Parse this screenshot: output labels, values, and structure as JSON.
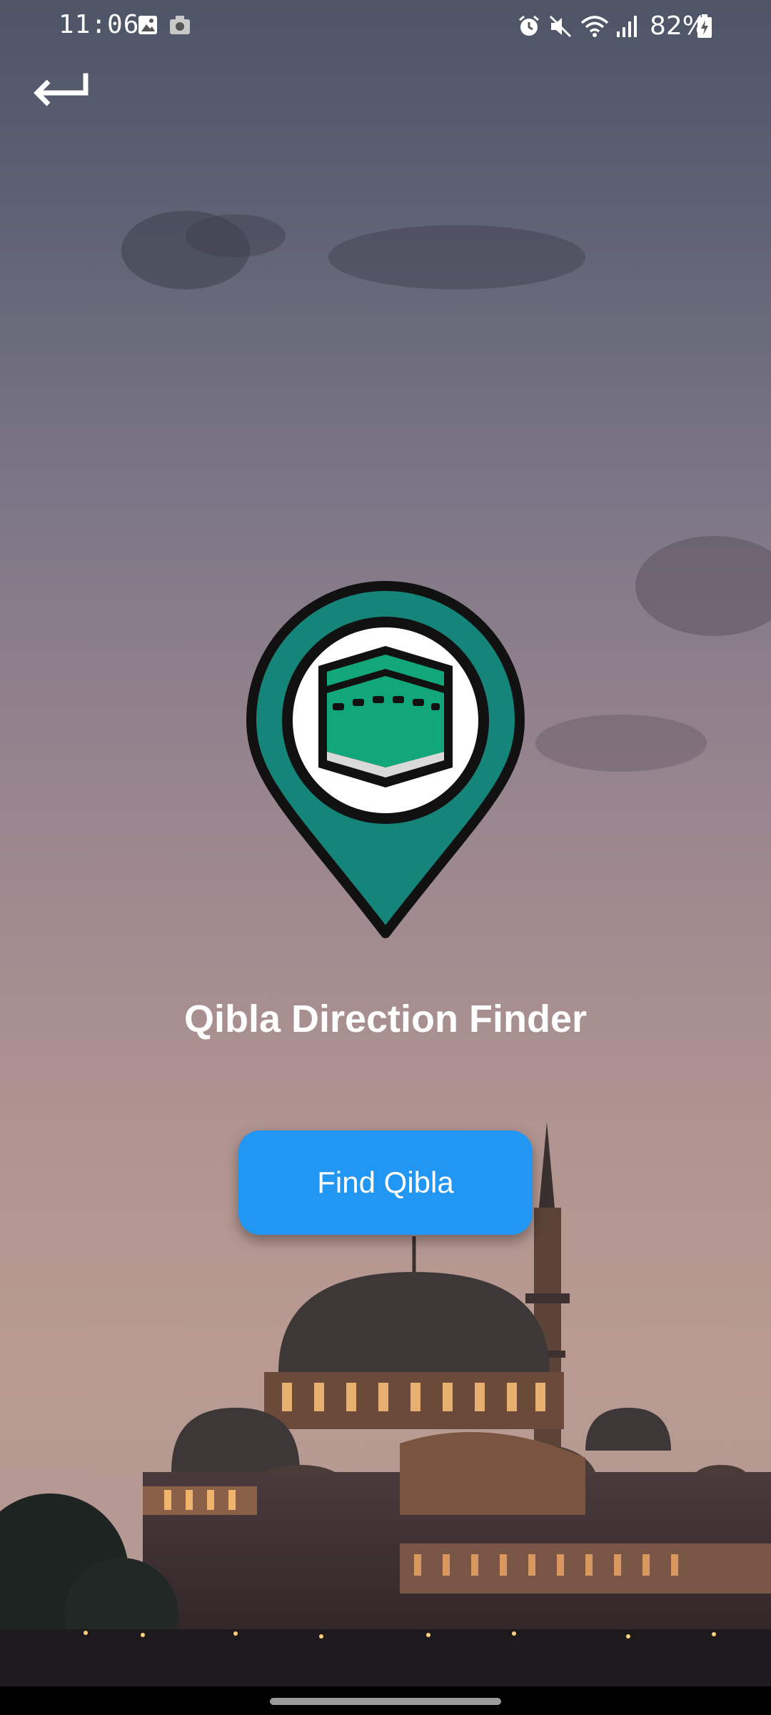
{
  "status_bar": {
    "time": "11:06",
    "battery": "82%",
    "icons": [
      "image-icon",
      "camera-icon",
      "alarm-icon",
      "mute-icon",
      "wifi-icon",
      "signal-icon",
      "battery-charging-icon"
    ]
  },
  "header": {
    "back_icon": "back-arrow-icon"
  },
  "logo": {
    "icon": "kaaba-location-pin-icon",
    "colors": {
      "pin": "#15857a",
      "kaaba": "#12a77a",
      "outline": "#111111"
    }
  },
  "main": {
    "title": "Qibla Direction Finder",
    "find_button_label": "Find Qibla",
    "accent_color": "#2196f3"
  },
  "background": {
    "image": "mosque-at-dusk-photo"
  }
}
